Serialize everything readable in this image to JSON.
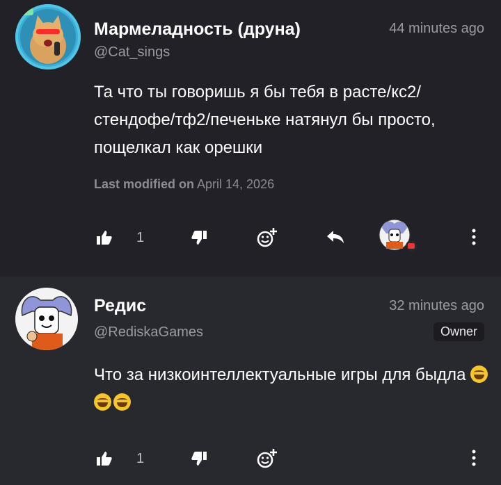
{
  "comments": [
    {
      "name": "Мармеладность (друна)",
      "handle": "@Cat_sings",
      "time": "44 minutes ago",
      "text": "Та что ты говоришь я бы тебя в расте/кс2/ стендофе/тф2/печеньке натянул бы просто, пощелкал как орешки",
      "modified_label": "Last modified on",
      "modified_date": "April 14, 2026",
      "likes": "1",
      "avatar": "cat-avatar"
    },
    {
      "name": "Редис",
      "handle": "@RediskaGames",
      "time": "32 minutes ago",
      "badge": "Owner",
      "text": "Что за низкоинтеллектуальные игры для быдла",
      "emojis": [
        "joy-emoji",
        "joy-emoji",
        "joy-emoji"
      ],
      "likes": "1",
      "avatar": "dog-avatar"
    }
  ],
  "icons": [
    "like-icon",
    "dislike-icon",
    "add-reaction-icon",
    "reply-icon",
    "more-options-icon"
  ],
  "colors": {
    "background_top": "#212127",
    "background_bottom": "#28282f",
    "muted": "#9a9aa2",
    "accent_blue": "#51c5e6"
  }
}
